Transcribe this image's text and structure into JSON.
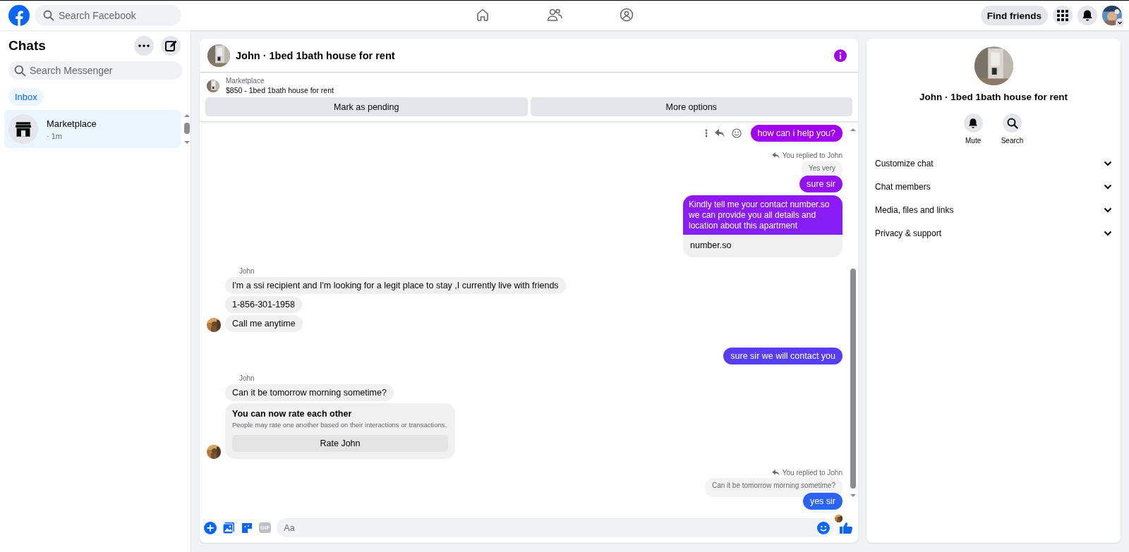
{
  "topbar": {
    "search": {
      "placeholder": "Search Facebook"
    },
    "nav": [
      {
        "kind": "home",
        "selected": false
      },
      {
        "kind": "friends",
        "selected": false
      },
      {
        "kind": "groups",
        "selected": false
      }
    ],
    "find_friends": "Find friends"
  },
  "sidebar": {
    "title": "Chats",
    "search": {
      "placeholder": "Search Messenger"
    },
    "tabs": [
      {
        "label": "Inbox",
        "selected": true
      }
    ],
    "chats": [
      {
        "name": "Marketplace",
        "time": "· 1m",
        "selected": true
      }
    ]
  },
  "chat": {
    "title": "John · 1bed 1bath house for rent",
    "listing": {
      "source": "Marketplace",
      "title": "$850 - 1bed 1bath house for rent",
      "buttons": [
        "Mark as pending",
        "More options"
      ]
    },
    "thread": [
      {
        "kind": "out",
        "text": "how can i help you?",
        "show_actions": true
      },
      {
        "kind": "reply_note",
        "text": "You replied to John"
      },
      {
        "kind": "quote",
        "text": "Yes very"
      },
      {
        "kind": "out",
        "text": "sure sir",
        "show_actions": false
      },
      {
        "kind": "out_link",
        "text": "Kindly tell me your contact number.so we can provide you all details and location about this apartment",
        "preview": "number.so"
      },
      {
        "kind": "sender",
        "text": "John"
      },
      {
        "kind": "in",
        "text": "I'm a ssi recipient and I'm looking for a legit place to stay ,I currently live with friends",
        "avatar": false
      },
      {
        "kind": "in",
        "text": "1-856-301-1958",
        "avatar": false
      },
      {
        "kind": "in",
        "text": "Call me anytime",
        "avatar": true
      },
      {
        "kind": "out",
        "text": "sure sir  we will contact you",
        "show_actions": false
      },
      {
        "kind": "sender",
        "text": "John"
      },
      {
        "kind": "in",
        "text": "Can it be tomorrow morning sometime?",
        "avatar": false
      },
      {
        "kind": "rating",
        "title": "You can now rate each other",
        "body": "People may rate one another based on their interactions or transactions.",
        "button": "Rate John",
        "avatar": true
      },
      {
        "kind": "reply_note",
        "text": "You replied to John"
      },
      {
        "kind": "quote",
        "text": "Can it be tomorrow morning sometime?"
      },
      {
        "kind": "out",
        "text": "yes sir",
        "show_actions": false
      },
      {
        "kind": "seen"
      }
    ],
    "composer": {
      "gif": "GIF",
      "placeholder": "Aa"
    }
  },
  "details": {
    "title": "John · 1bed 1bath house for rent",
    "actions": [
      {
        "kind": "mute",
        "label": "Mute"
      },
      {
        "kind": "search",
        "label": "Search"
      }
    ],
    "sections": [
      "Customize chat",
      "Chat members",
      "Media, files and links",
      "Privacy & support"
    ]
  }
}
